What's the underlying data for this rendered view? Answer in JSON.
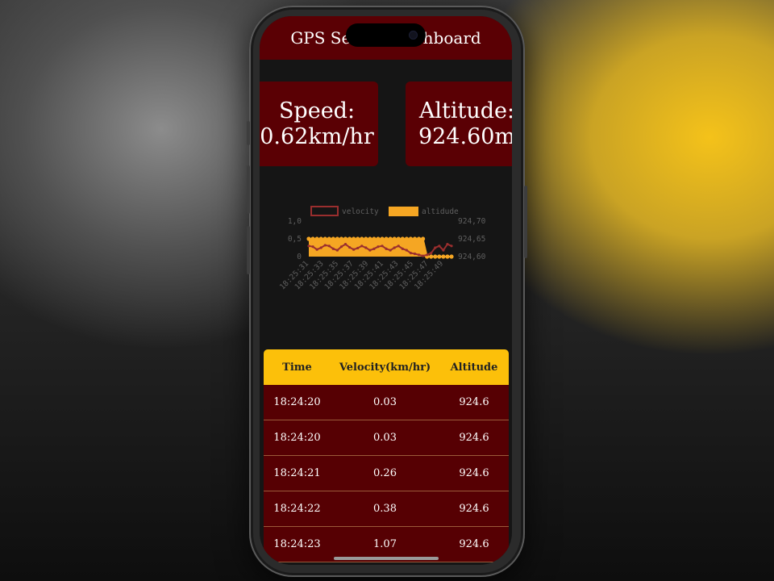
{
  "header": {
    "title": "GPS Sensor Dashboard"
  },
  "speed_card": {
    "label": "Speed:",
    "value": "0.62km/hr"
  },
  "altitude_card": {
    "label": "Altitude:",
    "value": "924.60m"
  },
  "chart_data": {
    "type": "line",
    "legend": [
      "velocity",
      "altidude"
    ],
    "legend_placement": "top",
    "colors": {
      "velocity": "#9a2e2e",
      "altidude": "#f5a623"
    },
    "y_left_ticks": [
      "1,0",
      "0,5",
      "0"
    ],
    "y_left_range": [
      0,
      1.0
    ],
    "y_right_ticks": [
      "924,70",
      "924,65",
      "924,60"
    ],
    "y_right_range": [
      924.6,
      924.7
    ],
    "x_tick_labels": [
      "18:25:31",
      "18:25:33",
      "18:25:35",
      "18:25:37",
      "18:25:39",
      "18:25:41",
      "18:25:43",
      "18:25:45",
      "18:25:47",
      "18:25:49"
    ],
    "series": [
      {
        "name": "velocity",
        "axis": "left",
        "values": [
          0.3,
          0.28,
          0.2,
          0.25,
          0.32,
          0.3,
          0.22,
          0.18,
          0.28,
          0.35,
          0.26,
          0.2,
          0.24,
          0.3,
          0.25,
          0.18,
          0.22,
          0.28,
          0.3,
          0.22,
          0.18,
          0.25,
          0.3,
          0.22,
          0.18,
          0.1,
          0.08,
          0.05,
          0.02,
          0.05,
          0.1,
          0.25,
          0.3,
          0.18,
          0.35,
          0.3
        ]
      },
      {
        "name": "altidude",
        "axis": "right",
        "values": [
          924.65,
          924.65,
          924.65,
          924.65,
          924.65,
          924.65,
          924.65,
          924.65,
          924.65,
          924.65,
          924.65,
          924.65,
          924.65,
          924.65,
          924.65,
          924.65,
          924.65,
          924.65,
          924.65,
          924.65,
          924.65,
          924.65,
          924.65,
          924.65,
          924.65,
          924.65,
          924.65,
          924.65,
          924.65,
          924.6,
          924.6,
          924.6,
          924.6,
          924.6,
          924.6,
          924.6
        ]
      }
    ]
  },
  "table": {
    "headers": {
      "time": "Time",
      "velocity": "Velocity(km/hr)",
      "altitude": "Altitude"
    },
    "rows": [
      {
        "time": "18:24:20",
        "velocity": "0.03",
        "altitude": "924.6"
      },
      {
        "time": "18:24:20",
        "velocity": "0.03",
        "altitude": "924.6"
      },
      {
        "time": "18:24:21",
        "velocity": "0.26",
        "altitude": "924.6"
      },
      {
        "time": "18:24:22",
        "velocity": "0.38",
        "altitude": "924.6"
      },
      {
        "time": "18:24:23",
        "velocity": "1.07",
        "altitude": "924.6"
      }
    ]
  }
}
